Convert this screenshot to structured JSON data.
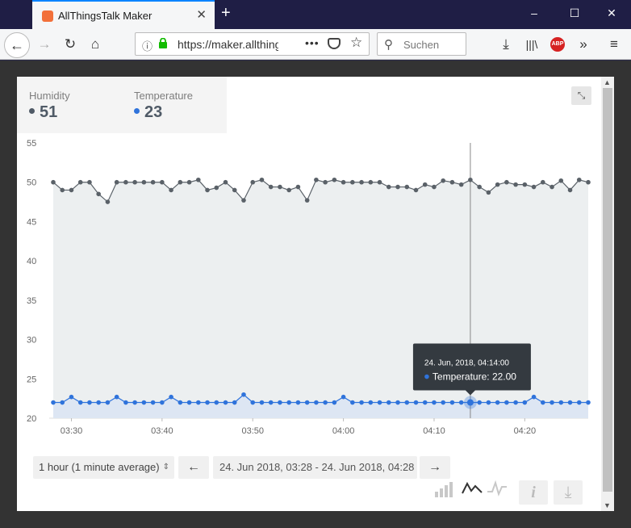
{
  "browser": {
    "tab_title": "AllThingsTalk Maker",
    "url": "https://maker.allthingstalk.com",
    "search_placeholder": "Suchen",
    "abp_label": "ABP"
  },
  "metrics": [
    {
      "label": "Humidity",
      "value": "51",
      "color": "#4f5a66"
    },
    {
      "label": "Temperature",
      "value": "23",
      "color": "#2f73db"
    }
  ],
  "controls": {
    "range_label": "1 hour (1 minute average)",
    "date_range": "24. Jun 2018, 03:28 - 24. Jun 2018, 04:28"
  },
  "tooltip": {
    "title": "24. Jun, 2018, 04:14:00",
    "label": "Temperature: 22.00"
  },
  "chart_data": {
    "type": "line",
    "x_tick_labels": [
      "03:30",
      "03:40",
      "03:50",
      "04:00",
      "04:10",
      "04:20"
    ],
    "x_tick_minutes": [
      2,
      12,
      22,
      32,
      42,
      52
    ],
    "x_minutes": [
      0,
      1,
      2,
      3,
      4,
      5,
      6,
      7,
      8,
      9,
      10,
      11,
      12,
      13,
      14,
      15,
      16,
      17,
      18,
      19,
      20,
      21,
      22,
      23,
      24,
      25,
      26,
      27,
      28,
      29,
      30,
      31,
      32,
      33,
      34,
      35,
      36,
      37,
      38,
      39,
      40,
      41,
      42,
      43,
      44,
      45,
      46,
      47,
      48,
      49,
      50,
      51,
      52,
      53,
      54,
      55,
      56,
      57,
      58,
      59
    ],
    "ylim": [
      20,
      55
    ],
    "yticks": [
      20,
      25,
      30,
      35,
      40,
      45,
      50,
      55
    ],
    "grid": false,
    "hover_minute": 46,
    "series": [
      {
        "name": "Humidity",
        "color": "#5a6168",
        "fill": "#eceff0",
        "values": [
          50,
          49,
          49,
          50,
          50,
          48.5,
          47.5,
          50,
          50,
          50,
          50,
          50,
          50,
          49,
          50,
          50,
          50.3,
          49,
          49.3,
          50,
          49,
          47.7,
          50,
          50.3,
          49.4,
          49.4,
          49,
          49.4,
          47.7,
          50.3,
          50,
          50.3,
          50,
          50,
          50,
          50,
          50,
          49.4,
          49.4,
          49.4,
          49,
          49.7,
          49.4,
          50.2,
          50,
          49.7,
          50.3,
          49.4,
          48.7,
          49.7,
          50,
          49.7,
          49.7,
          49.4,
          50,
          49.4,
          50.2,
          49,
          50.3,
          50
        ]
      },
      {
        "name": "Temperature",
        "color": "#2f73db",
        "fill": "#dde6f3",
        "values": [
          22,
          22,
          22.7,
          22,
          22,
          22,
          22,
          22.7,
          22,
          22,
          22,
          22,
          22,
          22.7,
          22,
          22,
          22,
          22,
          22,
          22,
          22,
          23,
          22,
          22,
          22,
          22,
          22,
          22,
          22,
          22,
          22,
          22,
          22.7,
          22,
          22,
          22,
          22,
          22,
          22,
          22,
          22,
          22,
          22,
          22,
          22,
          22,
          22,
          22,
          22,
          22,
          22,
          22,
          22,
          22.7,
          22,
          22,
          22,
          22,
          22,
          22
        ]
      }
    ]
  }
}
